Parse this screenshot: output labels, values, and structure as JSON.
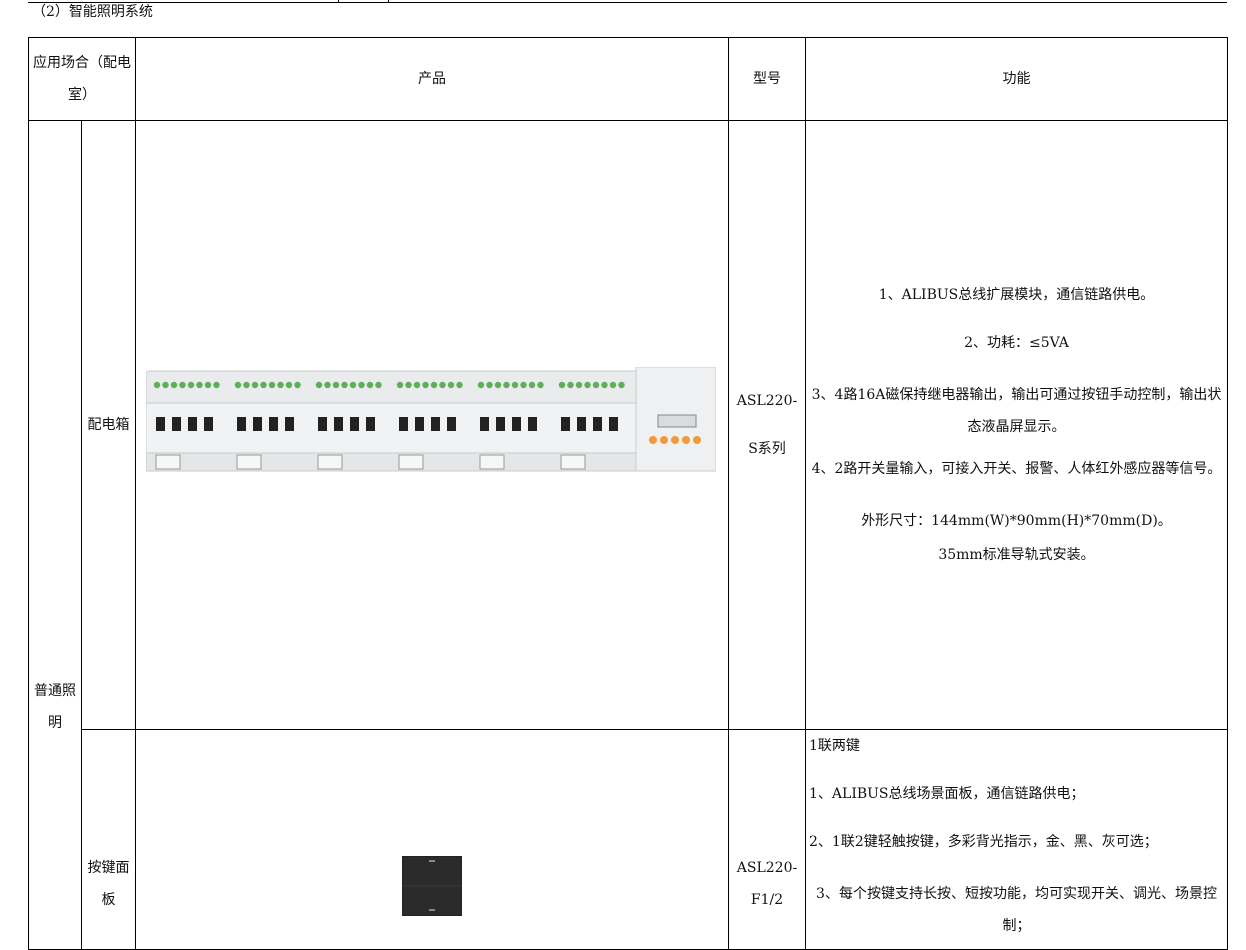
{
  "section_title": "（2）智能照明系统",
  "headers": {
    "place": "应用场合（配电室）",
    "product": "产品",
    "model": "型号",
    "function": "功能"
  },
  "rows": [
    {
      "group": "普通照明",
      "item": "配电箱",
      "model": "ASL220-S系列",
      "functions": [
        "1、ALIBUS总线扩展模块，通信链路供电。",
        "2、功耗：≤5VA",
        "3、4路16A磁保持继电器输出，输出可通过按钮手动控制，输出状态液晶屏显示。",
        "4、2路开关量输入，可接入开关、报警、人体红外感应器等信号。",
        "外形尺寸：144mm(W)*90mm(H)*70mm(D)。",
        "35mm标准导轨式安装。"
      ]
    },
    {
      "item": "按键面板",
      "model": "ASL220-F1/2",
      "functions": [
        "1联两键",
        "1、ALIBUS总线场景面板，通信链路供电；",
        "2、1联2键轻触按键，多彩背光指示，金、黑、灰可选；",
        "3、每个按键支持长按、短按功能，均可实现开关、调光、场景控制；"
      ]
    }
  ],
  "colors": {
    "module_body": "#e9ebec",
    "terminal_green": "#5fae5a",
    "button_orange": "#f29a3a",
    "panel_black": "#2b2b2b"
  }
}
